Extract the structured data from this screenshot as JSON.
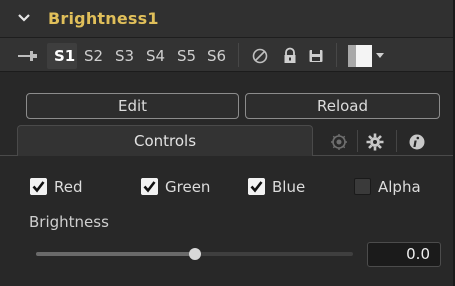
{
  "header": {
    "title": "Brightness1",
    "title_color": "#e0bf5a"
  },
  "toolbar": {
    "slots": [
      "S1",
      "S2",
      "S3",
      "S4",
      "S5",
      "S6"
    ],
    "active_slot": "S1",
    "icons": [
      "pin-icon",
      "disable-icon",
      "lock-icon",
      "save-icon",
      "color-swatch-icon"
    ]
  },
  "buttons": {
    "edit": "Edit",
    "reload": "Reload"
  },
  "tabs": {
    "controls": "Controls",
    "icon_tabs": [
      "modifiers-icon",
      "settings-gear-icon",
      "info-icon"
    ]
  },
  "channels": [
    {
      "label": "Red",
      "checked": true
    },
    {
      "label": "Green",
      "checked": true
    },
    {
      "label": "Blue",
      "checked": true
    },
    {
      "label": "Alpha",
      "checked": false
    }
  ],
  "brightness": {
    "label": "Brightness",
    "value": "0.0",
    "slider_fraction": 0.5
  }
}
